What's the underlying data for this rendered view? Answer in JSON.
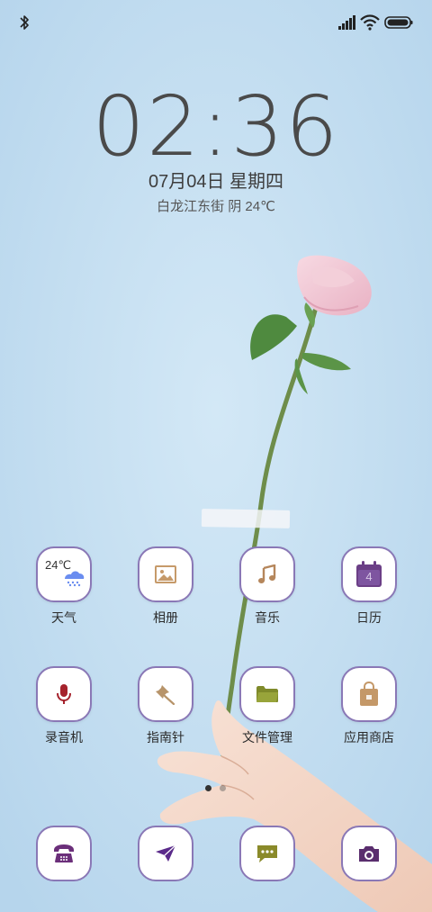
{
  "status_bar": {
    "bluetooth_icon": "bluetooth-icon",
    "signal_icon": "signal-icon",
    "wifi_icon": "wifi-icon",
    "battery_icon": "battery-icon"
  },
  "lockscreen": {
    "time": "02:36",
    "date": "07月04日 星期四",
    "weather": "白龙江东街 阴 24℃"
  },
  "apps": [
    {
      "label": "天气",
      "icon": "weather-icon",
      "temp": "24℃"
    },
    {
      "label": "相册",
      "icon": "gallery-icon"
    },
    {
      "label": "音乐",
      "icon": "music-icon"
    },
    {
      "label": "日历",
      "icon": "calendar-icon",
      "day": "4"
    },
    {
      "label": "录音机",
      "icon": "microphone-icon"
    },
    {
      "label": "指南针",
      "icon": "compass-pin-icon"
    },
    {
      "label": "文件管理",
      "icon": "folder-icon"
    },
    {
      "label": "应用商店",
      "icon": "store-bag-icon"
    }
  ],
  "dock": [
    {
      "icon": "phone-icon"
    },
    {
      "icon": "send-icon"
    },
    {
      "icon": "message-icon"
    },
    {
      "icon": "camera-icon"
    }
  ],
  "pages": {
    "current": 1,
    "total": 2
  },
  "colors": {
    "icon_border": "#8a78b6",
    "weather_blue": "#6a8df0",
    "gallery_tan": "#c69a6a",
    "music_tan": "#b5865b",
    "calendar_purple": "#6b3f86",
    "mic_red": "#a5222c",
    "pin_tan": "#b7946a",
    "folder_olive": "#7f8a2a",
    "store_tan": "#c49868",
    "phone_purple": "#6b2f7a",
    "send_purple": "#5a2a8a",
    "message_olive": "#8a8a2a",
    "camera_purple": "#5a2e6e"
  }
}
